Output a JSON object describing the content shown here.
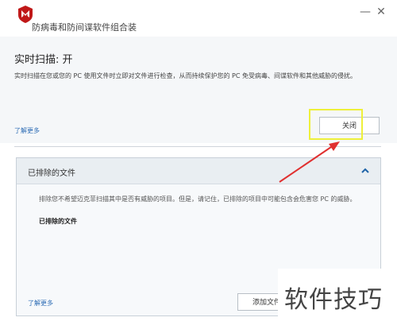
{
  "window": {
    "title": "防病毒和防间谍软件组合装",
    "brand_color": "#c01818",
    "minimize_glyph": "—",
    "close_glyph": "✕"
  },
  "header": {
    "title": "实时扫描: 开",
    "description": "实时扫描在您或您的 PC 使用文件时立即对文件进行检查，从而持续保护您的 PC 免受病毒、间谍软件和其他威胁的侵扰。",
    "learn_more": "了解更多",
    "off_button": "关闭"
  },
  "excluded_panel": {
    "title": "已排除的文件",
    "description": "排除您不希望迈克菲扫描其中是否有威胁的项目。但是，请记住，已排除的项目中可能包含会危害您 PC 的威胁。",
    "list_label": "已排除的文件",
    "learn_more": "了解更多",
    "add_file_button": "添加文件"
  },
  "annotation": {
    "highlight_color": "#eef03a",
    "arrow_color": "#e03030"
  },
  "watermark": {
    "text": "软件技巧"
  }
}
